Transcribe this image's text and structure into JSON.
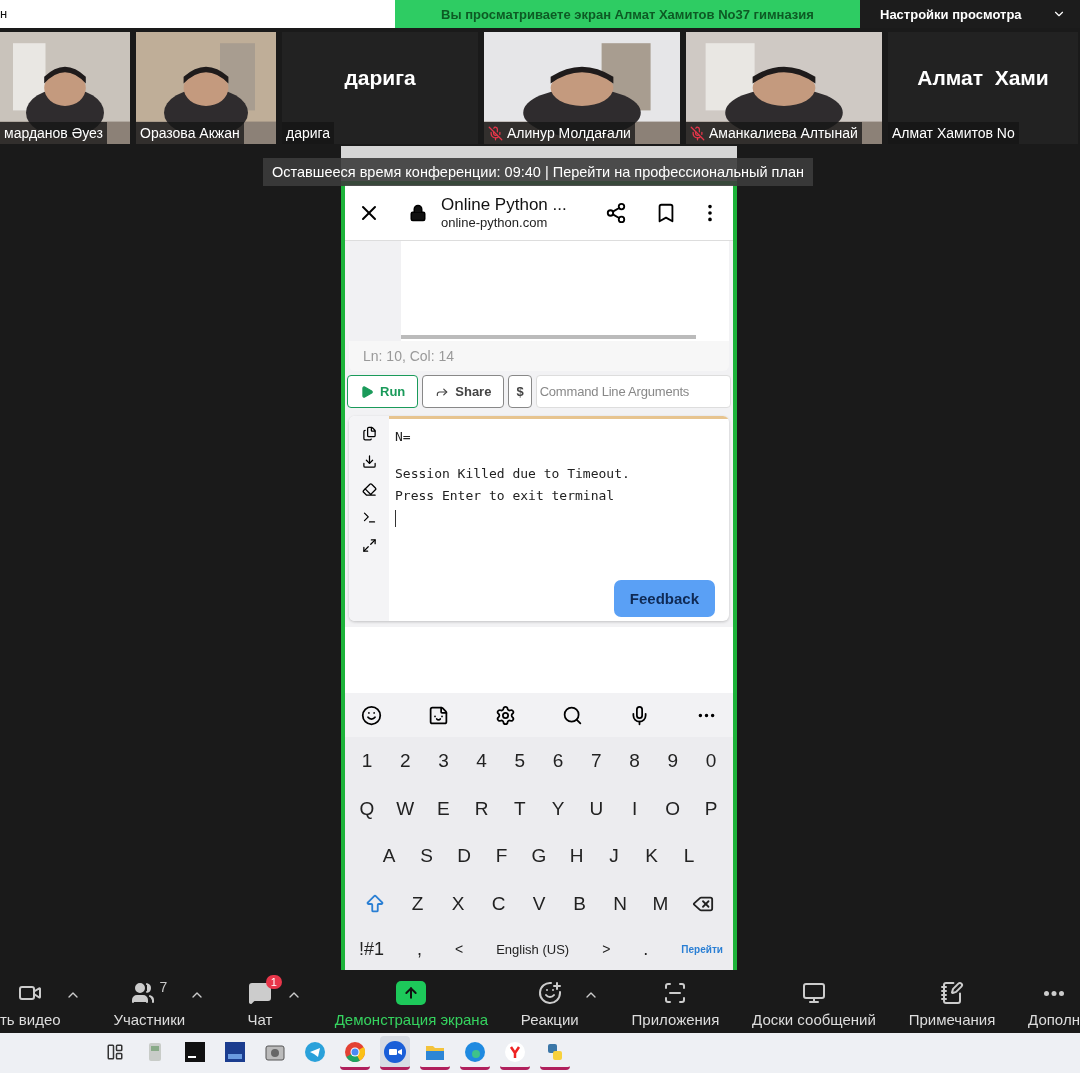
{
  "top_bar": {
    "left_text": "н",
    "banner": "Вы просматриваете экран Алмат Хамитов No37 гимназия",
    "view_settings": "Настройки просмотра"
  },
  "participants": [
    {
      "kind": "video",
      "name": "марданов Әуез",
      "muted": false
    },
    {
      "kind": "video",
      "name": "Оразова Акжан",
      "muted": false
    },
    {
      "kind": "text",
      "display": "дарига",
      "name": "дарига",
      "muted": false
    },
    {
      "kind": "video",
      "name": "Алинур Молдағали",
      "muted": true
    },
    {
      "kind": "video",
      "name": "Аманкалиева Алтынай",
      "muted": true
    },
    {
      "kind": "text",
      "display": "Алмат  Хами",
      "name": "Алмат Хамитов No",
      "muted": false
    }
  ],
  "time_notice": "Оставшееся время конференции: 09:40 | Перейти на профессиональный план",
  "browser": {
    "title": "Online Python ...",
    "url": "online-python.com"
  },
  "editor": {
    "status": "Ln: 10,  Col: 14"
  },
  "actions": {
    "run": "Run",
    "share": "Share",
    "dollar": "$",
    "args_placeholder": "Command Line Arguments"
  },
  "terminal": {
    "prompt": "N=",
    "message": [
      "Session Killed due to Timeout.",
      "Press Enter to exit terminal"
    ],
    "feedback": "Feedback"
  },
  "keyboard": {
    "rows": [
      {
        "kind": "numbers",
        "keys": [
          "1",
          "2",
          "3",
          "4",
          "5",
          "6",
          "7",
          "8",
          "9",
          "0"
        ]
      },
      {
        "kind": "letters",
        "keys": [
          "Q",
          "W",
          "E",
          "R",
          "T",
          "Y",
          "U",
          "I",
          "O",
          "P"
        ]
      },
      {
        "kind": "middle",
        "keys": [
          "A",
          "S",
          "D",
          "F",
          "G",
          "H",
          "J",
          "K",
          "L"
        ]
      },
      {
        "kind": "shift",
        "keys": [
          "Z",
          "X",
          "C",
          "V",
          "B",
          "N",
          "M"
        ]
      }
    ],
    "bottom": {
      "symbols": "!#1",
      "comma": ",",
      "prev": "<",
      "language": "English (US)",
      "next": ">",
      "period": ".",
      "action": "Перейти"
    }
  },
  "toolbar": [
    {
      "kind": "video",
      "label": "ть видео",
      "menu": true
    },
    {
      "kind": "participants",
      "label": "Участники",
      "count": "7",
      "menu": true
    },
    {
      "kind": "chat",
      "label": "Чат",
      "badge": "1",
      "menu": true
    },
    {
      "kind": "share",
      "label": "Демонстрация экрана",
      "menu": false
    },
    {
      "kind": "reactions",
      "label": "Реакции",
      "menu": true
    },
    {
      "kind": "apps",
      "label": "Приложения",
      "menu": false
    },
    {
      "kind": "whiteboards",
      "label": "Доски сообщений",
      "menu": false
    },
    {
      "kind": "notes",
      "label": "Примечания",
      "menu": false
    },
    {
      "kind": "more",
      "label": "Дополн",
      "menu": false
    }
  ],
  "taskbar": [
    {
      "kind": "task-view",
      "running": false,
      "selected": false
    },
    {
      "kind": "drive",
      "running": false,
      "selected": false
    },
    {
      "kind": "ide",
      "running": false,
      "selected": false
    },
    {
      "kind": "dev",
      "running": false,
      "selected": false
    },
    {
      "kind": "camera",
      "running": false,
      "selected": false
    },
    {
      "kind": "telegram",
      "running": false,
      "selected": false
    },
    {
      "kind": "chrome",
      "running": true,
      "selected": false
    },
    {
      "kind": "zoom",
      "running": true,
      "selected": true
    },
    {
      "kind": "folder",
      "running": true,
      "selected": false
    },
    {
      "kind": "edge",
      "running": true,
      "selected": false
    },
    {
      "kind": "yandex",
      "running": true,
      "selected": false
    },
    {
      "kind": "python",
      "running": true,
      "selected": false
    }
  ]
}
